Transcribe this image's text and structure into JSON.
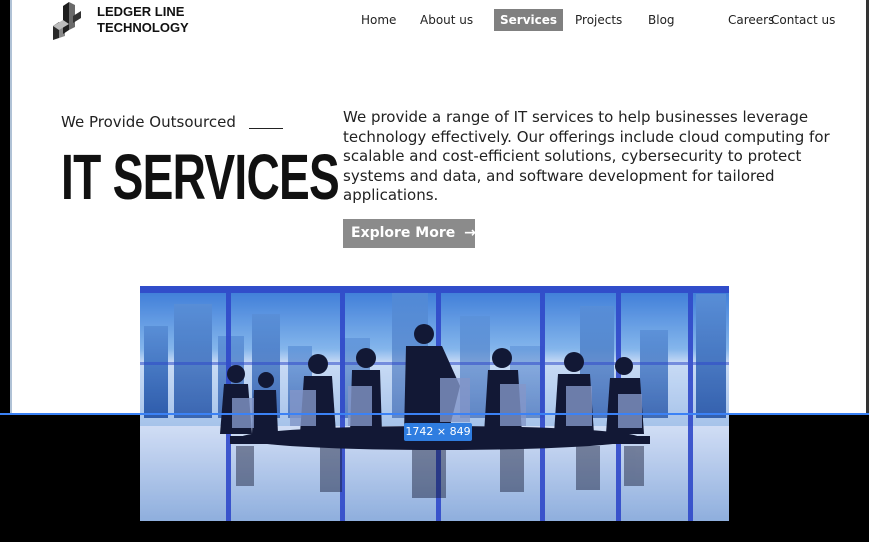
{
  "brand": {
    "logo_icon": "ledger-line-logo-mark",
    "line1": "LEDGER LINE",
    "line2": "TECHNOLOGY"
  },
  "nav": {
    "items": [
      {
        "label": "Home",
        "active": false
      },
      {
        "label": "About us",
        "active": false
      },
      {
        "label": "Services",
        "active": true
      },
      {
        "label": "Projects",
        "active": false
      },
      {
        "label": "Blog",
        "active": false
      },
      {
        "label": "Careers",
        "active": false
      },
      {
        "label": "Contact us",
        "active": false
      }
    ]
  },
  "hero": {
    "eyebrow": "We Provide Outsourced",
    "title": "IT SERVICES",
    "description": "We provide a range of IT services to help businesses leverage technology effectively. Our offerings include cloud computing for scalable and cost-efficient solutions, cybersecurity to protect systems and data, and software development for tailored applications.",
    "cta_label": "Explore More",
    "cta_icon": "arrow-right-icon"
  },
  "image": {
    "icon": "business-meeting-photo",
    "size_badge": "1742 × 849"
  },
  "colors": {
    "active_nav": "#808080",
    "cta_bg": "#8b8b8b",
    "selection_blue": "#3b82f6",
    "photo_tint": "#2f48c9"
  }
}
